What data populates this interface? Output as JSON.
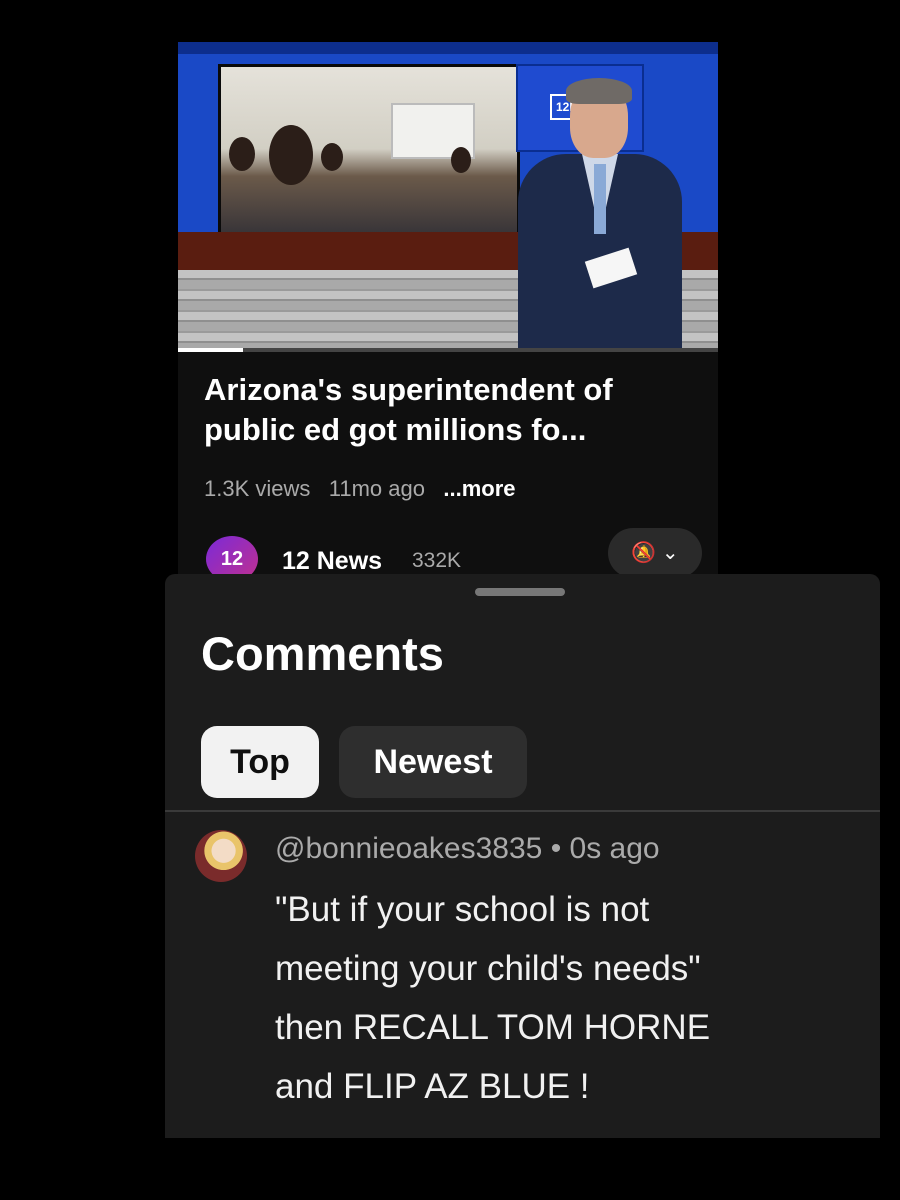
{
  "video": {
    "title": "Arizona's superintendent of public ed got millions fo...",
    "views": "1.3K views",
    "age": "11mo ago",
    "more_label": "...more",
    "progress_fraction": 0.12,
    "thumbnail_logo": "12N"
  },
  "channel": {
    "avatar_text": "12",
    "name": "12 News",
    "subscribers": "332K",
    "bell_icon": "bell-off-icon",
    "bell_label": "🔕 ⌄"
  },
  "comments": {
    "title": "Comments",
    "sort_chips": [
      {
        "label": "Top",
        "selected": true
      },
      {
        "label": "Newest",
        "selected": false
      }
    ],
    "items": [
      {
        "author": "@bonnieoakes3835",
        "time": "0s ago",
        "text": "\"But if your school is not\nmeeting your child's needs\"\nthen RECALL TOM HORNE\nand FLIP AZ BLUE !"
      }
    ]
  },
  "colors": {
    "background": "#000000",
    "surface": "#1c1c1c",
    "chip_selected": "#f2f2f2",
    "muted_text": "#aaaaaa",
    "thumbnail_blue": "#1a49c6"
  }
}
